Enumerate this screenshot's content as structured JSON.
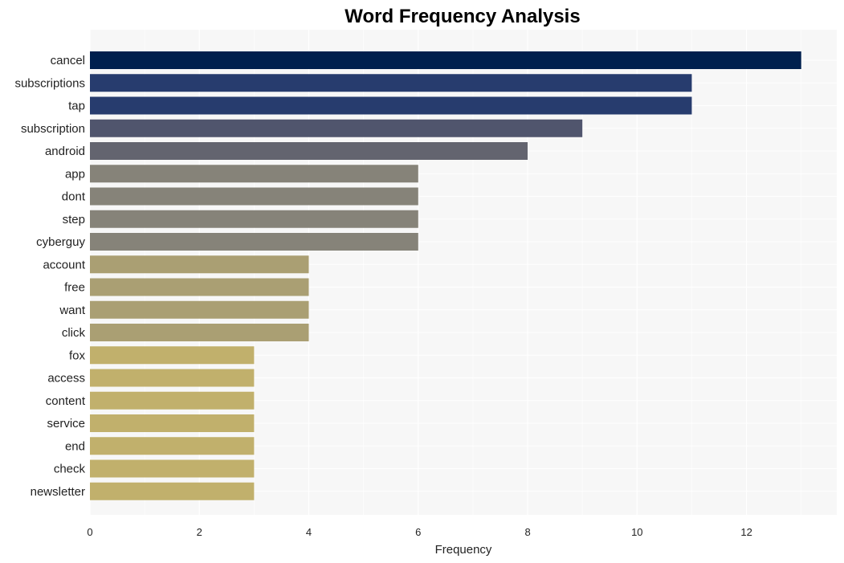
{
  "chart_data": {
    "type": "bar",
    "orientation": "horizontal",
    "title": "Word Frequency Analysis",
    "xlabel": "Frequency",
    "ylabel": "",
    "xlim": [
      0,
      13.65
    ],
    "xticks": [
      0,
      2,
      4,
      6,
      8,
      10,
      12
    ],
    "grid": true,
    "legend": "none",
    "categories": [
      "cancel",
      "subscriptions",
      "tap",
      "subscription",
      "android",
      "app",
      "dont",
      "step",
      "cyberguy",
      "account",
      "free",
      "want",
      "click",
      "fox",
      "access",
      "content",
      "service",
      "end",
      "check",
      "newsletter"
    ],
    "values": [
      13,
      11,
      11,
      9,
      8,
      6,
      6,
      6,
      6,
      4,
      4,
      4,
      4,
      3,
      3,
      3,
      3,
      3,
      3,
      3
    ],
    "colors": [
      "#00204e",
      "#273c6e",
      "#273c6e",
      "#50556d",
      "#63646f",
      "#868379",
      "#868379",
      "#868379",
      "#868379",
      "#aa9f73",
      "#aa9f73",
      "#aa9f73",
      "#aa9f73",
      "#c1b06c",
      "#c1b06c",
      "#c1b06c",
      "#c1b06c",
      "#c1b06c",
      "#c1b06c",
      "#c1b06c"
    ],
    "plot_background": "#f7f7f7",
    "grid_color": "#ffffff"
  }
}
